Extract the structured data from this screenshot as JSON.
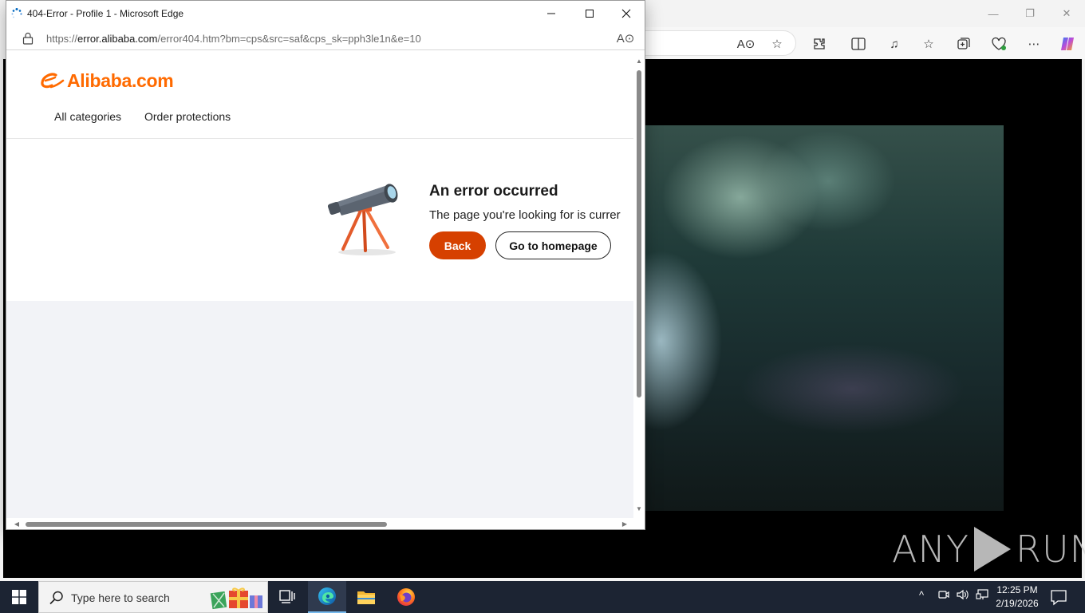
{
  "popup": {
    "title": "404-Error - Profile 1 - Microsoft Edge",
    "url_scheme": "https://",
    "url_host": "error.alibaba.com",
    "url_path": "/error404.htm?bm=cps&src=saf&cps_sk=pph3le1n&e=10"
  },
  "page": {
    "logo_text": "Alibaba.com",
    "nav": [
      "All categories",
      "Order protections"
    ],
    "error_title": "An error occurred",
    "error_desc": "The page you're looking for is currer",
    "back_label": "Back",
    "home_label": "Go to homepage"
  },
  "watermark": {
    "left": "ANY",
    "right": "RUN"
  },
  "taskbar": {
    "search_placeholder": "Type here to search",
    "time": "12:25 PM",
    "date": "2/19/2026"
  },
  "colors": {
    "brand": "#ff6a00",
    "back_button": "#d64000",
    "taskbar": "#1c2433"
  }
}
